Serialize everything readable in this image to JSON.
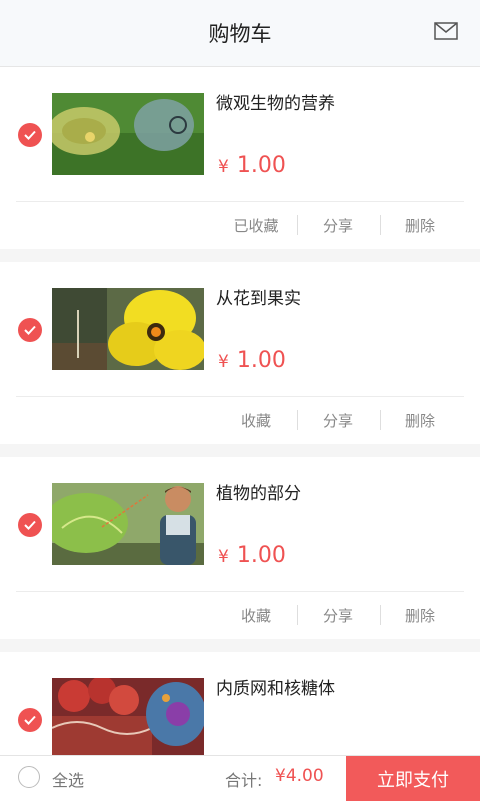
{
  "header": {
    "title": "购物车",
    "mail_icon": "mail-icon"
  },
  "items": [
    {
      "name": "微观生物的营养",
      "currency": "¥",
      "price": "1.00",
      "fav_label": "已收藏",
      "share_label": "分享",
      "delete_label": "删除",
      "checked": true
    },
    {
      "name": "从花到果实",
      "currency": "¥",
      "price": "1.00",
      "fav_label": "收藏",
      "share_label": "分享",
      "delete_label": "删除",
      "checked": true
    },
    {
      "name": "植物的部分",
      "currency": "¥",
      "price": "1.00",
      "fav_label": "收藏",
      "share_label": "分享",
      "delete_label": "删除",
      "checked": true
    },
    {
      "name": "内质网和核糖体",
      "checked": true
    }
  ],
  "footer": {
    "select_all_label": "全选",
    "total_label": "合计:",
    "total_value": "¥4.00",
    "pay_label": "立即支付"
  },
  "colors": {
    "accent": "#ef5252",
    "pay_button": "#f25a5a",
    "header_bg": "#f7f9fb"
  }
}
